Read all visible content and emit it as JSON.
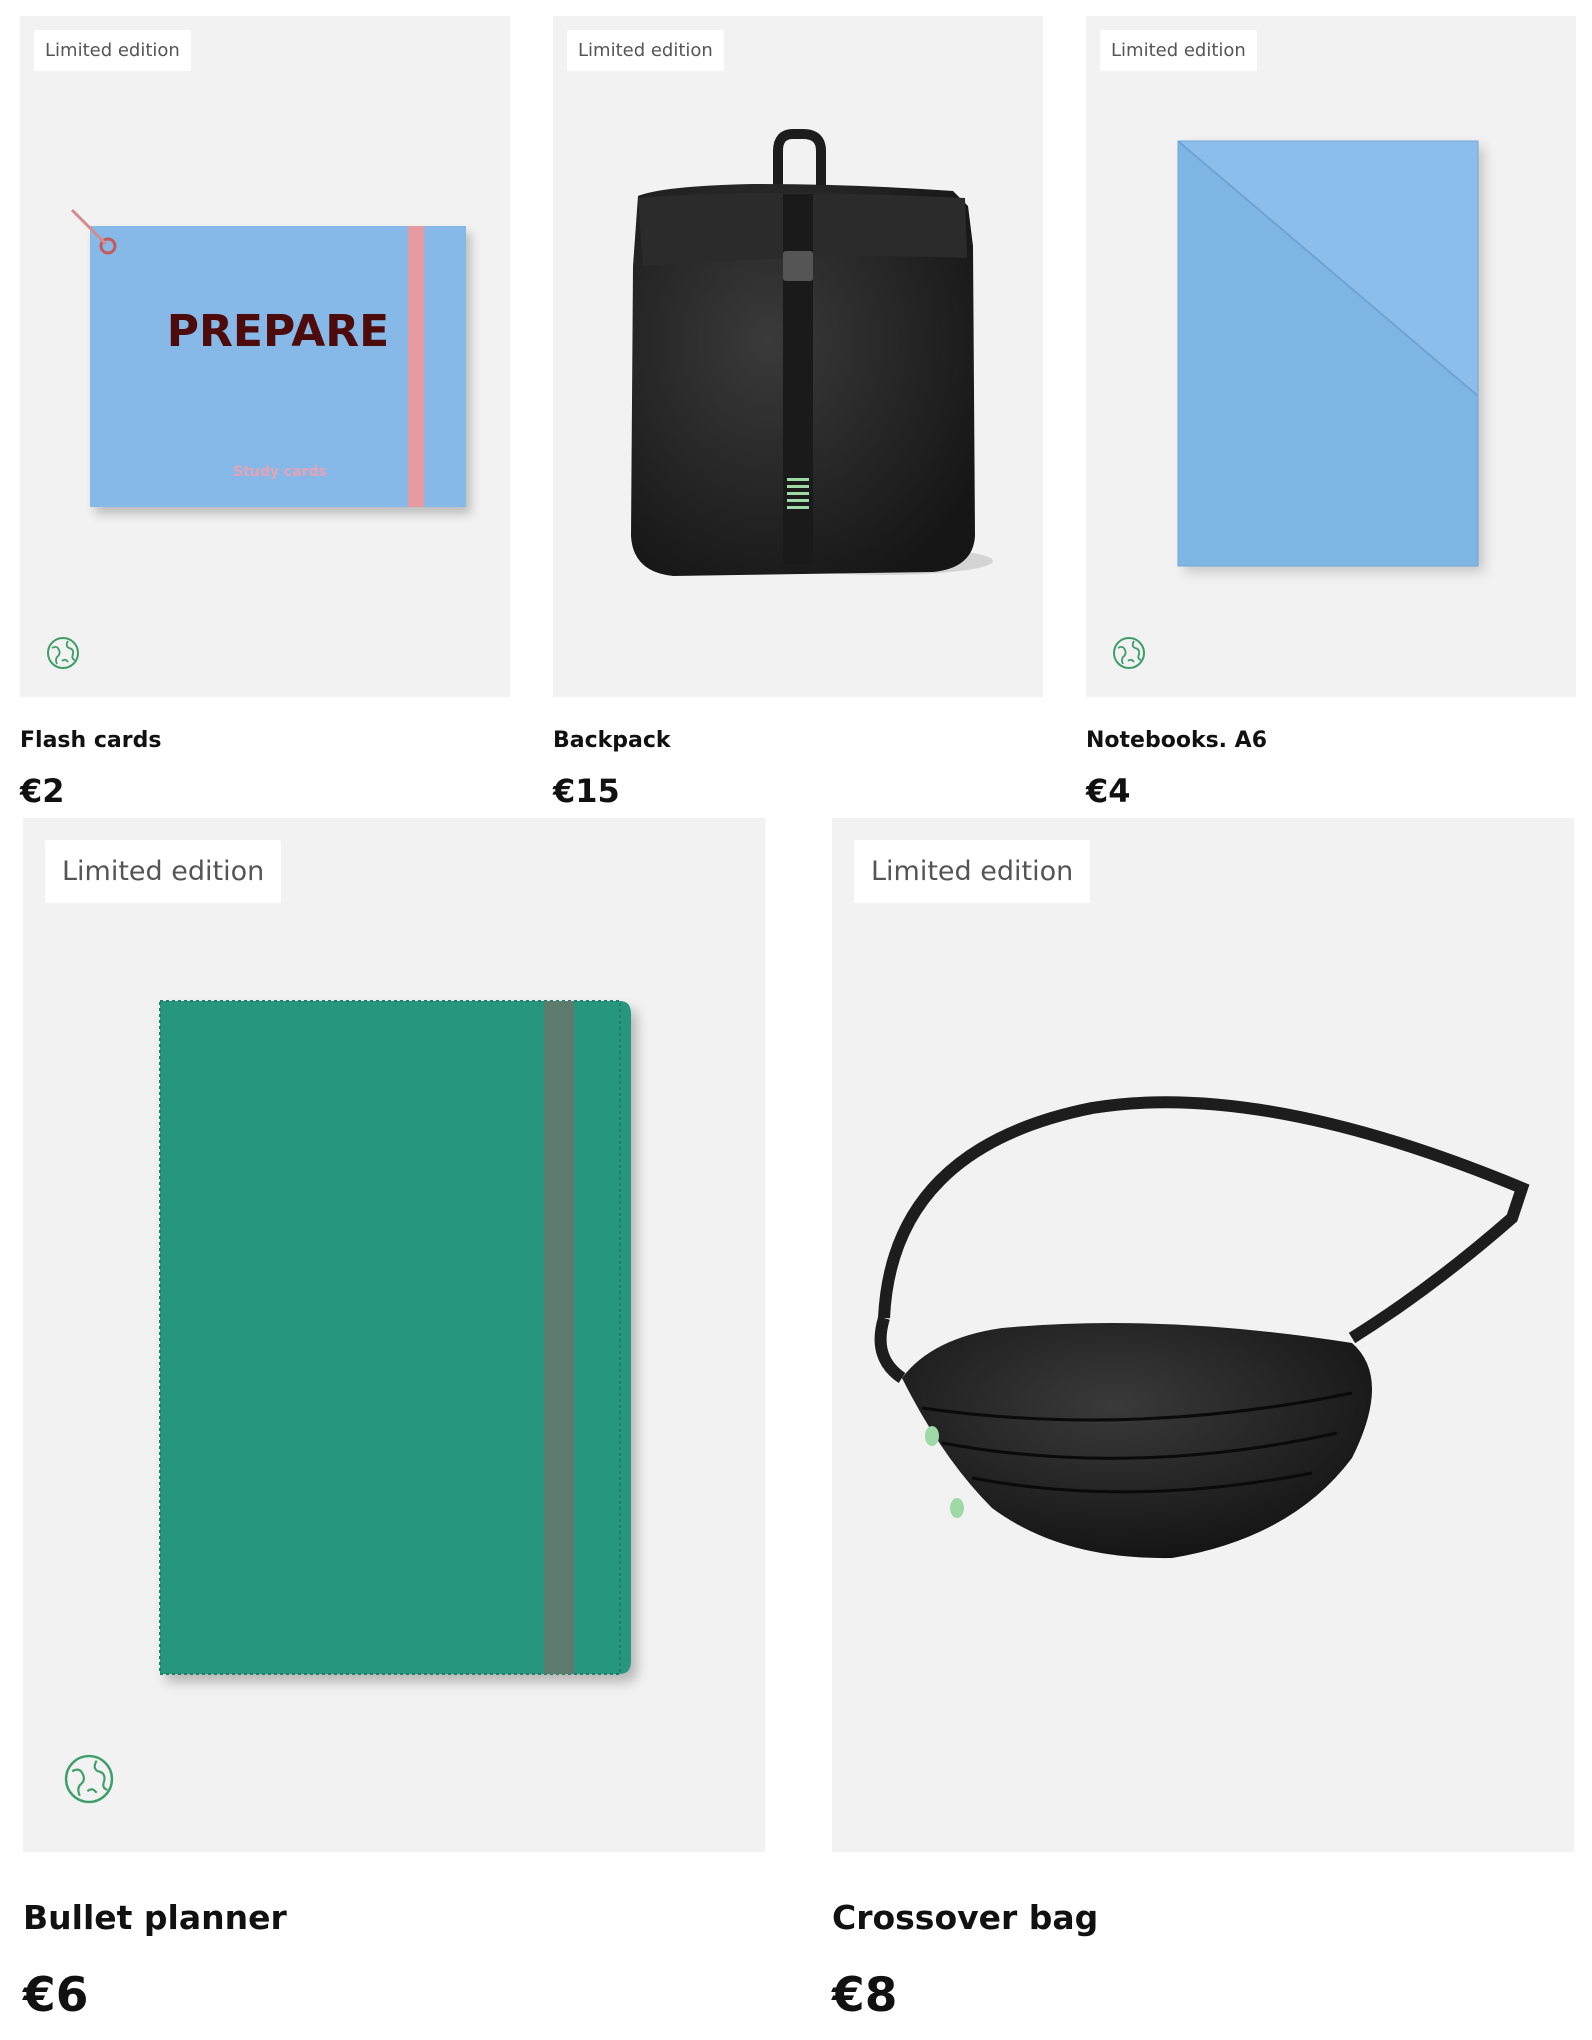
{
  "products": [
    {
      "badge": "Limited edition",
      "name": "Flash cards",
      "price": "€2",
      "eco": true,
      "image": "flash-cards",
      "cover_text": "PREPARE",
      "cover_sub": "Study cards"
    },
    {
      "badge": "Limited edition",
      "name": "Backpack",
      "price": "€15",
      "eco": false,
      "image": "backpack"
    },
    {
      "badge": "Limited edition",
      "name": "Notebooks. A6",
      "price": "€4",
      "eco": true,
      "image": "notebooks"
    },
    {
      "badge": "Limited edition",
      "name": "Bullet planner",
      "price": "€6",
      "eco": true,
      "image": "bullet-planner"
    },
    {
      "badge": "Limited edition",
      "name": "Crossover bag",
      "price": "€8",
      "eco": false,
      "image": "crossover-bag"
    }
  ],
  "colors": {
    "card_bg": "#f2f2f2",
    "flash_card_blue": "#86b8e8",
    "elastic_pink": "#e79a9f",
    "prepare_text": "#4d0b0b",
    "notebook_blue": "#7fb5e3",
    "planner_green": "#25977e",
    "planner_band": "#5d7c6e",
    "bag_black": "#1d1d1e",
    "eco_green": "#3f9e68"
  }
}
